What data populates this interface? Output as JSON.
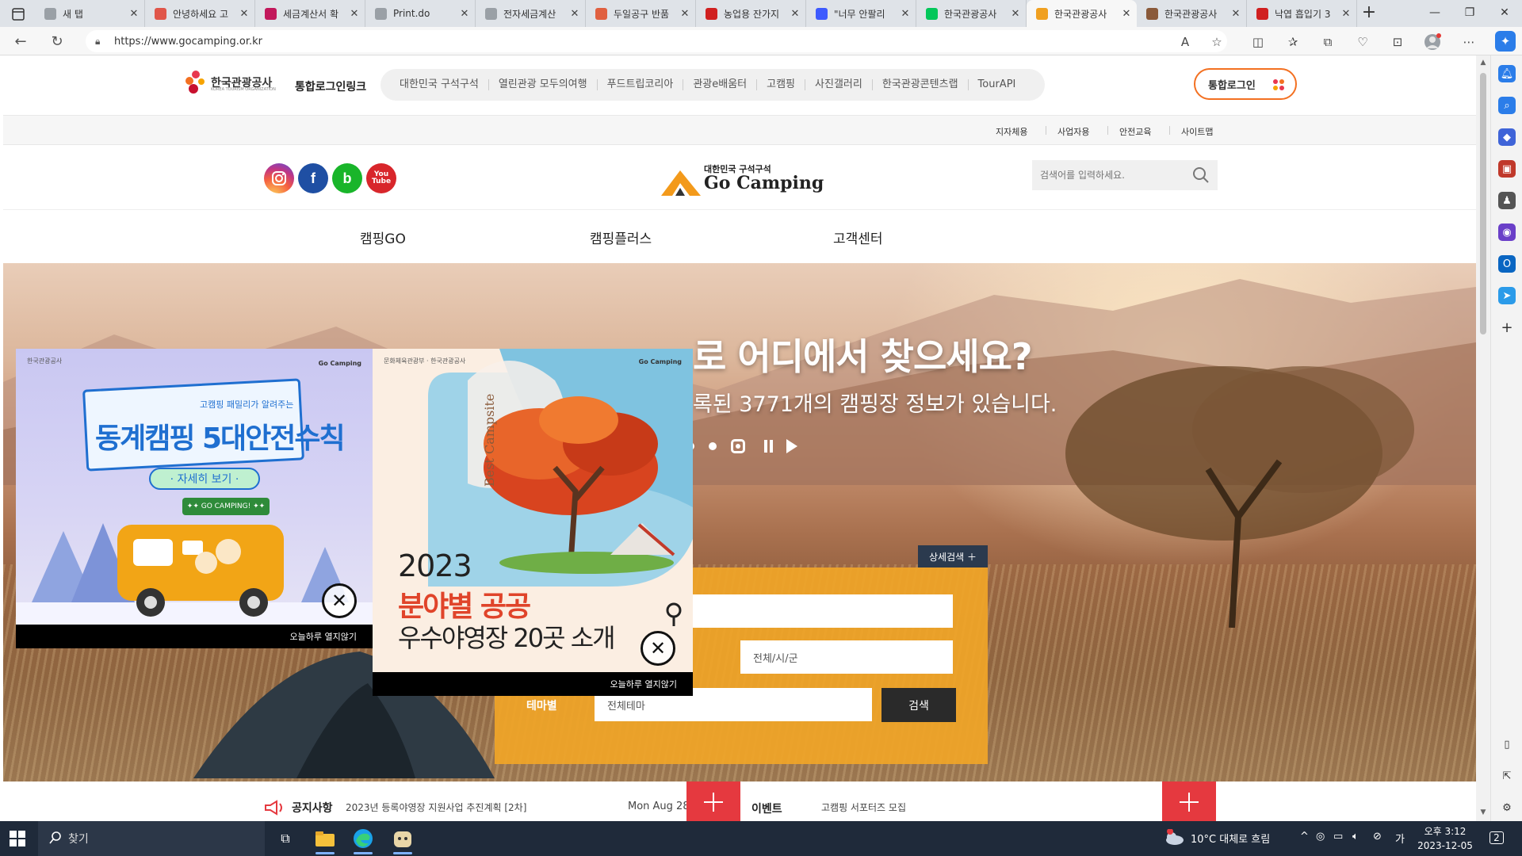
{
  "browser": {
    "tabs": [
      {
        "title": "새 탭",
        "fav": "#9aa0a6"
      },
      {
        "title": "안녕하세요 고",
        "fav": "#e0564a"
      },
      {
        "title": "세금계산서 확",
        "fav": "#c2185b"
      },
      {
        "title": "Print.do",
        "fav": "#9aa0a6"
      },
      {
        "title": "전자세금계산",
        "fav": "#9aa0a6"
      },
      {
        "title": "두일공구 반품",
        "fav": "#e06040"
      },
      {
        "title": "농업용 잔가지",
        "fav": "#d02020"
      },
      {
        "title": "\"너무 안팔리",
        "fav": "#3d5afe"
      },
      {
        "title": "한국관광공사",
        "fav": "#03c75a"
      },
      {
        "title": "한국관광공사",
        "fav": "#f0a020",
        "active": true
      },
      {
        "title": "한국관광공사",
        "fav": "#8a5a3a"
      },
      {
        "title": "낙엽 흡입기 3",
        "fav": "#d02020"
      }
    ],
    "url": "https://www.gocamping.or.kr"
  },
  "site": {
    "kto": {
      "logo_name": "한국관광공사",
      "logo_sub": "KOREA TOURISM ORGANIZATION",
      "link_title": "통합로그인링크",
      "links": [
        "대한민국 구석구석",
        "열린관광 모두의여행",
        "푸드트립코리아",
        "관광e배움터",
        "고캠핑",
        "사진갤러리",
        "한국관광콘텐츠랩",
        "TourAPI"
      ],
      "login": "통합로그인"
    },
    "util": [
      "지자체용",
      "사업자용",
      "안전교육",
      "사이트맵"
    ],
    "logo": {
      "small": "대한민국 구석구석",
      "big": "Go Camping"
    },
    "search_placeholder": "검색어를 입력하세요.",
    "gnb": [
      "캠핑GO",
      "캠핑플러스",
      "고객센터"
    ],
    "hero": {
      "title": "로 어디에서 찾으세요?",
      "subtitle": "록된 3771개의 캠핑장 정보가 있습니다.",
      "detail_search": "상세검색 ＋",
      "field_keyword": "",
      "field_region": "",
      "field_city": "전체/시/군",
      "theme_label": "테마별",
      "field_theme": "전체테마",
      "search_btn": "검색"
    },
    "notice": {
      "title": "공지사항",
      "text": "2023년 등록야영장 지원사업 추진계획 [2차]",
      "date": "Mon Aug 28",
      "event_title": "이벤트",
      "event_text": "고캠핑 서포터즈 모집"
    },
    "popup1": {
      "brand_l": "한국관광공사",
      "brand_r": "Go Camping",
      "headline": "동계캠핑 5대안전수칙",
      "headline_small": "고캠핑 패밀리가 알려주는",
      "more": "· 자세히 보기 ·",
      "tag": "✦✦ GO CAMPING! ✦✦",
      "close_today": "오늘하루 열지않기"
    },
    "popup2": {
      "brand_l": "문화체육관광부 · 한국관광공사",
      "brand_r": "Go Camping",
      "vertical": "Best Campsite",
      "year": "2023",
      "t1": "분야별 공공",
      "t2": "우수야영장 20곳 소개",
      "close_today": "오늘하루 열지않기"
    }
  },
  "taskbar": {
    "search": "찾기",
    "weather": "10°C  대체로 흐림",
    "time": "오후 3:12",
    "date": "2023-12-05",
    "notif_count": "2"
  },
  "colors": {
    "accent": "#f0a528",
    "kto_orange": "#f37021",
    "red": "#e5393f"
  }
}
